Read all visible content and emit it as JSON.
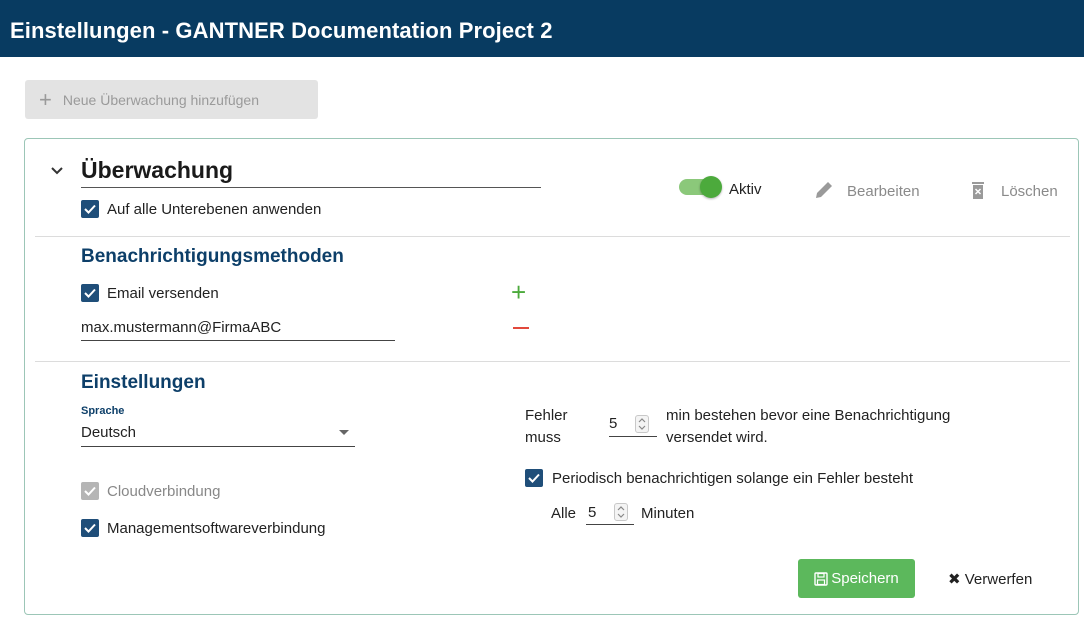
{
  "header": {
    "title": "Einstellungen - GANTNER Documentation Project 2"
  },
  "toolbar": {
    "add_label": "Neue Überwachung hinzufügen"
  },
  "monitor": {
    "title": "Überwachung",
    "apply_all_label": "Auf alle Unterebenen anwenden",
    "active_label": "Aktiv",
    "edit_label": "Bearbeiten",
    "delete_label": "Löschen"
  },
  "notifications": {
    "title": "Benachrichtigungsmethoden",
    "email_label": "Email versenden",
    "email_value": "max.mustermann@FirmaABC"
  },
  "settings": {
    "title": "Einstellungen",
    "language_label": "Sprache",
    "language_value": "Deutsch",
    "cloud_label": "Cloudverbindung",
    "mgmt_label": "Managementsoftwareverbindung",
    "error_prefix_1": "Fehler",
    "error_prefix_2": "muss",
    "error_minutes": "5",
    "error_suffix_1": "min bestehen bevor eine Benachrichtigung",
    "error_suffix_2": "versendet wird.",
    "periodic_label": "Periodisch benachrichtigen solange ein Fehler besteht",
    "every_label": "Alle",
    "every_value": "5",
    "minutes_label": "Minuten"
  },
  "actions": {
    "save_label": "Speichern",
    "discard_label": "Verwerfen"
  },
  "colors": {
    "header": "#083b61",
    "accent_green": "#5cb85c",
    "checkbox": "#1f4e79",
    "remove_red": "#e2493c"
  }
}
